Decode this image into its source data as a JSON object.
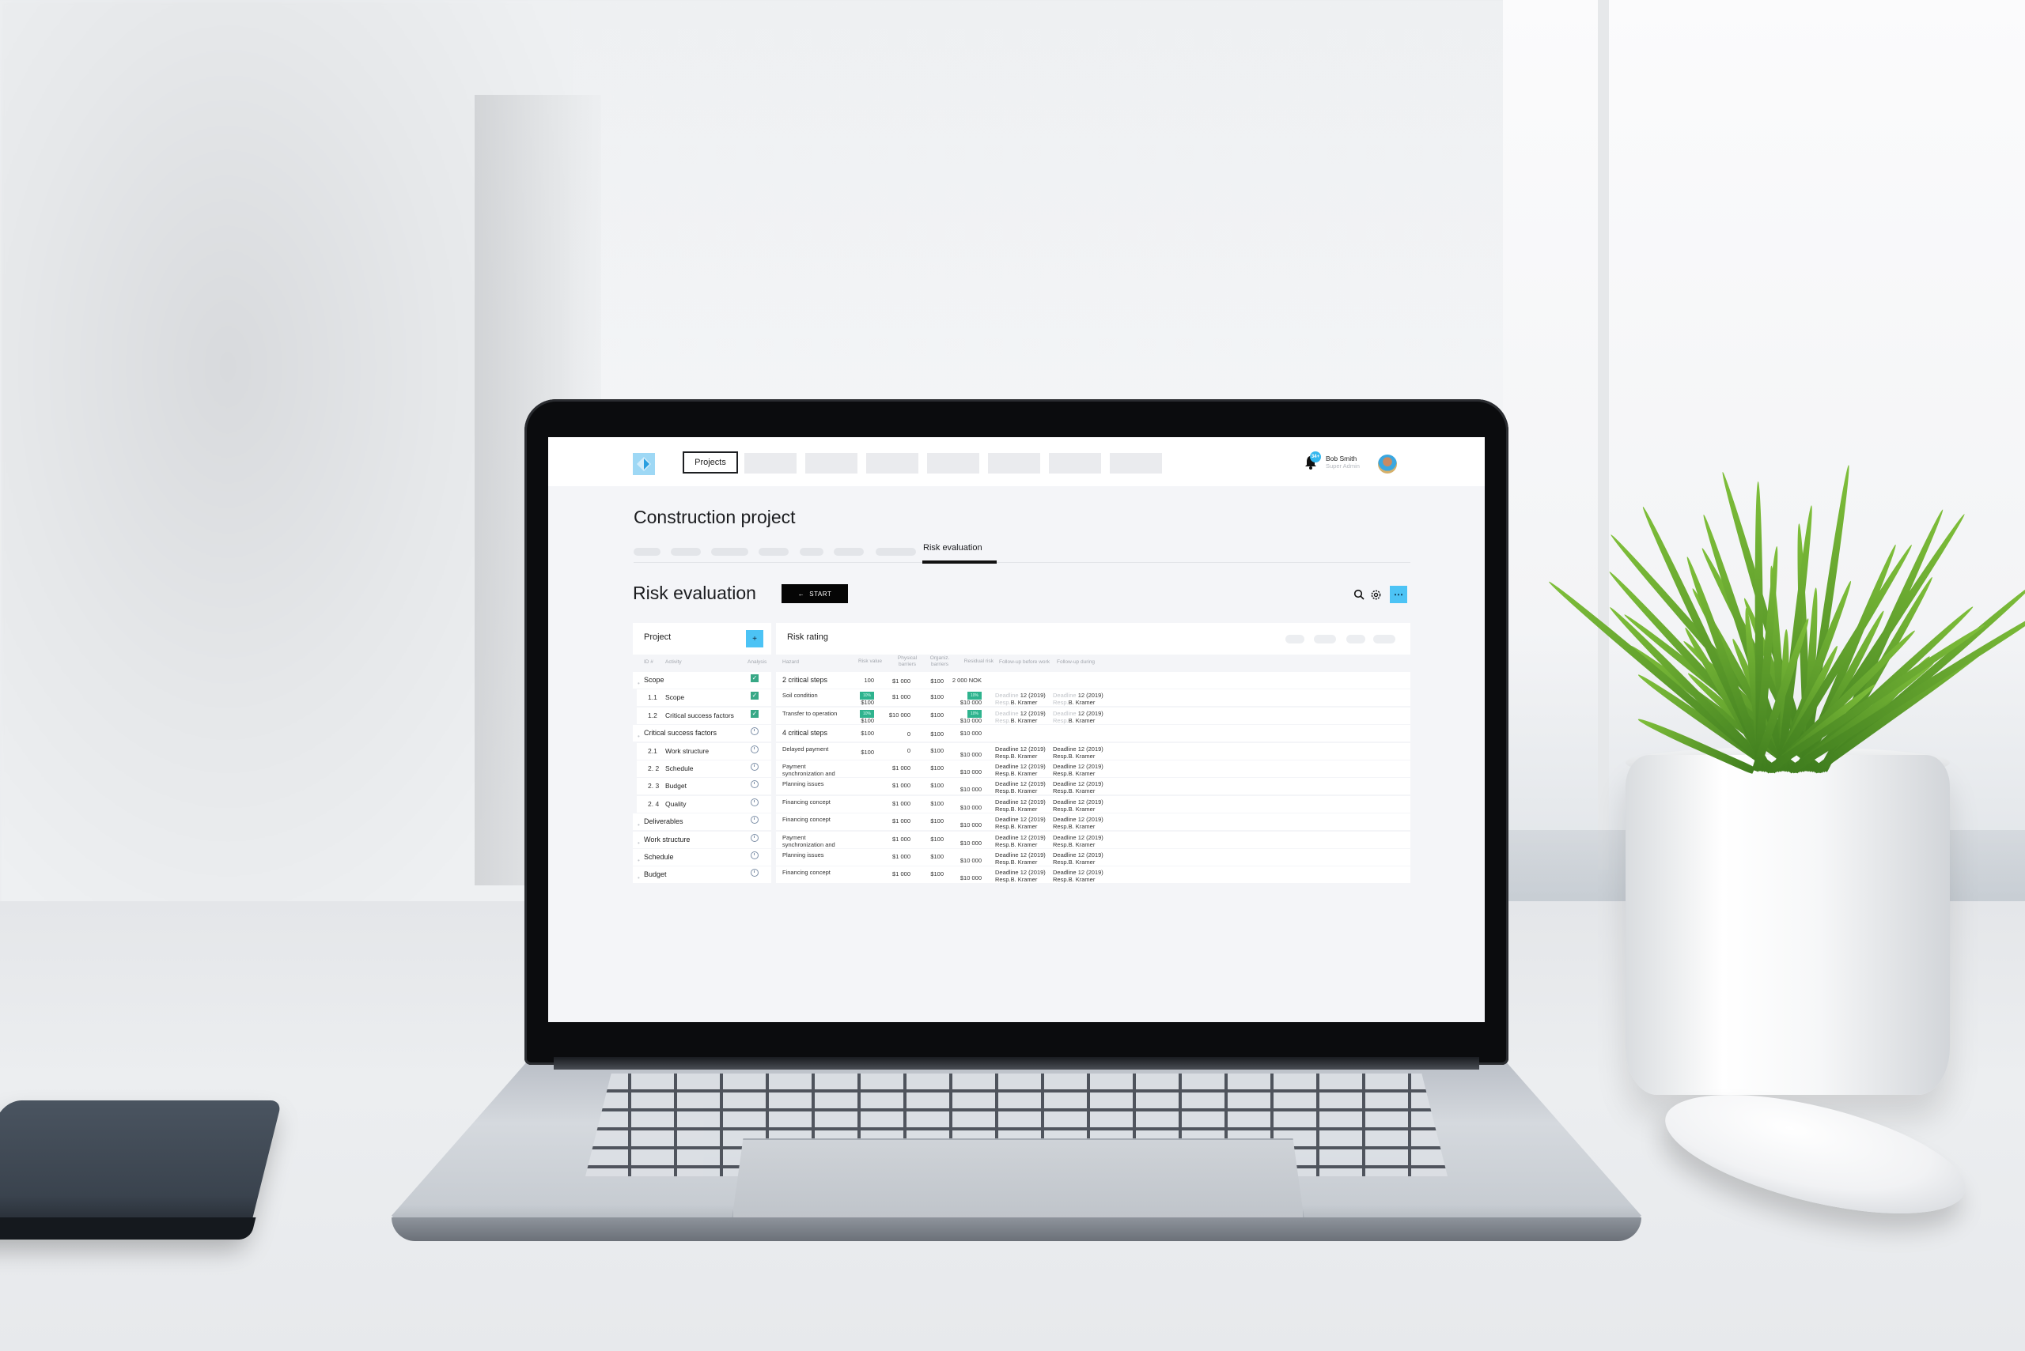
{
  "nav": {
    "logo": "app-logo",
    "projects_label": "Projects",
    "notification_count": "34+",
    "user_name": "Bob Smith",
    "user_role": "Super Admin"
  },
  "page": {
    "title": "Construction project",
    "active_tab": "Risk evaluation"
  },
  "section": {
    "title": "Risk evaluation",
    "start_label": "START",
    "start_icon": "arrow-left"
  },
  "colors": {
    "accent": "#4cc3f5",
    "done": "#37a886",
    "percent_pill": "#2fb38e",
    "dark": "#050505"
  },
  "project_panel": {
    "title": "Project",
    "add_label": "+",
    "columns": [
      "ID #",
      "Activity",
      "Analysis"
    ],
    "rows": [
      {
        "type": "group",
        "id": "",
        "activity": "Scope",
        "analysis": "done"
      },
      {
        "type": "child",
        "id": "1.1",
        "activity": "Scope",
        "analysis": "done"
      },
      {
        "type": "child",
        "id": "1.2",
        "activity": "Critical success factors",
        "analysis": "done"
      },
      {
        "type": "group",
        "id": "",
        "activity": "Critical success factors",
        "analysis": "pending"
      },
      {
        "type": "child",
        "id": "2.1",
        "activity": "Work structure",
        "analysis": "pending"
      },
      {
        "type": "child",
        "id": "2. 2",
        "activity": "Schedule",
        "analysis": "pending"
      },
      {
        "type": "child",
        "id": "2. 3",
        "activity": "Budget",
        "analysis": "pending"
      },
      {
        "type": "child",
        "id": "2. 4",
        "activity": "Quality",
        "analysis": "pending"
      },
      {
        "type": "group",
        "id": "",
        "activity": "Deliverables",
        "analysis": "pending"
      },
      {
        "type": "group",
        "id": "",
        "activity": "Work structure",
        "analysis": "pending"
      },
      {
        "type": "group",
        "id": "",
        "activity": "Schedule",
        "analysis": "pending"
      },
      {
        "type": "group",
        "id": "",
        "activity": "Budget",
        "analysis": "pending"
      }
    ]
  },
  "risk_panel": {
    "title": "Risk rating",
    "columns": [
      "Hazard",
      "Risk value",
      "Physical barriers",
      "Organiz. barriers",
      "Residual risk",
      "Follow-up before work",
      "Follow-up during"
    ],
    "followup_deadline_label": "Deadline",
    "followup_resp_label": "Resp.",
    "rows": [
      {
        "type": "group",
        "hazard": "2 critical steps",
        "risk_value": "100",
        "risk_pct": "",
        "physical": "$1 000",
        "organiz": "$100",
        "residual": "2 000 NOK",
        "residual_pct": "",
        "fu_before": null,
        "fu_during": null
      },
      {
        "type": "item",
        "hazard": "Soil condition",
        "risk_value": "$100",
        "risk_pct": "10%",
        "physical": "$1 000",
        "organiz": "$100",
        "residual": "$10 000",
        "residual_pct": "10%",
        "fu_before": {
          "deadline": "12 (2019)",
          "resp": "B. Kramer",
          "faded": true
        },
        "fu_during": {
          "deadline": "12 (2019)",
          "resp": "B. Kramer",
          "faded": true
        }
      },
      {
        "type": "item",
        "hazard": "Transfer to operation",
        "risk_value": "$100",
        "risk_pct": "10%",
        "physical": "$10 000",
        "organiz": "$100",
        "residual": "$10 000",
        "residual_pct": "10%",
        "fu_before": {
          "deadline": "12 (2019)",
          "resp": "B. Kramer",
          "faded": true
        },
        "fu_during": {
          "deadline": "12 (2019)",
          "resp": "B. Kramer",
          "faded": true
        }
      },
      {
        "type": "group",
        "hazard": "4 critical steps",
        "risk_value": "$100",
        "risk_pct": "",
        "physical": "0",
        "organiz": "$100",
        "residual": "$10 000",
        "residual_pct": "",
        "fu_before": null,
        "fu_during": null
      },
      {
        "type": "item",
        "hazard": "Delayed payment",
        "risk_value": "$100",
        "risk_pct": "",
        "physical": "0",
        "organiz": "$100",
        "residual": "$10 000",
        "residual_pct": "",
        "fu_before": {
          "deadline": "12 (2019)",
          "resp": "B. Kramer",
          "faded": false
        },
        "fu_during": {
          "deadline": "12 (2019)",
          "resp": "B. Kramer",
          "faded": false
        }
      },
      {
        "type": "item",
        "hazard": "Payment synchronization and cash flow negotiation",
        "risk_value": "",
        "risk_pct": "",
        "physical": "$1 000",
        "organiz": "$100",
        "residual": "$10 000",
        "residual_pct": "",
        "fu_before": {
          "deadline": "12 (2019)",
          "resp": "B. Kramer",
          "faded": false
        },
        "fu_during": {
          "deadline": "12 (2019)",
          "resp": "B. Kramer",
          "faded": false
        }
      },
      {
        "type": "item",
        "hazard": "Planning issues",
        "risk_value": "",
        "risk_pct": "",
        "physical": "$1 000",
        "organiz": "$100",
        "residual": "$10 000",
        "residual_pct": "",
        "fu_before": {
          "deadline": "12 (2019)",
          "resp": "B. Kramer",
          "faded": false
        },
        "fu_during": {
          "deadline": "12 (2019)",
          "resp": "B. Kramer",
          "faded": false
        }
      },
      {
        "type": "item",
        "hazard": "Financing concept",
        "risk_value": "",
        "risk_pct": "",
        "physical": "$1 000",
        "organiz": "$100",
        "residual": "$10 000",
        "residual_pct": "",
        "fu_before": {
          "deadline": "12 (2019)",
          "resp": "B. Kramer",
          "faded": false
        },
        "fu_during": {
          "deadline": "12 (2019)",
          "resp": "B. Kramer",
          "faded": false
        }
      },
      {
        "type": "item",
        "hazard": "Financing concept",
        "risk_value": "",
        "risk_pct": "",
        "physical": "$1 000",
        "organiz": "$100",
        "residual": "$10 000",
        "residual_pct": "",
        "fu_before": {
          "deadline": "12 (2019)",
          "resp": "B. Kramer",
          "faded": false
        },
        "fu_during": {
          "deadline": "12 (2019)",
          "resp": "B. Kramer",
          "faded": false
        }
      },
      {
        "type": "item",
        "hazard": "Payment synchronization and cash flow negotiation",
        "risk_value": "",
        "risk_pct": "",
        "physical": "$1 000",
        "organiz": "$100",
        "residual": "$10 000",
        "residual_pct": "",
        "fu_before": {
          "deadline": "12 (2019)",
          "resp": "B. Kramer",
          "faded": false
        },
        "fu_during": {
          "deadline": "12 (2019)",
          "resp": "B. Kramer",
          "faded": false
        }
      },
      {
        "type": "item",
        "hazard": "Planning issues",
        "risk_value": "",
        "risk_pct": "",
        "physical": "$1 000",
        "organiz": "$100",
        "residual": "$10 000",
        "residual_pct": "",
        "fu_before": {
          "deadline": "12 (2019)",
          "resp": "B. Kramer",
          "faded": false
        },
        "fu_during": {
          "deadline": "12 (2019)",
          "resp": "B. Kramer",
          "faded": false
        }
      },
      {
        "type": "item",
        "hazard": "Financing concept",
        "risk_value": "",
        "risk_pct": "",
        "physical": "$1 000",
        "organiz": "$100",
        "residual": "$10 000",
        "residual_pct": "",
        "fu_before": {
          "deadline": "12 (2019)",
          "resp": "B. Kramer",
          "faded": false
        },
        "fu_during": {
          "deadline": "12 (2019)",
          "resp": "B. Kramer",
          "faded": false
        }
      }
    ]
  }
}
